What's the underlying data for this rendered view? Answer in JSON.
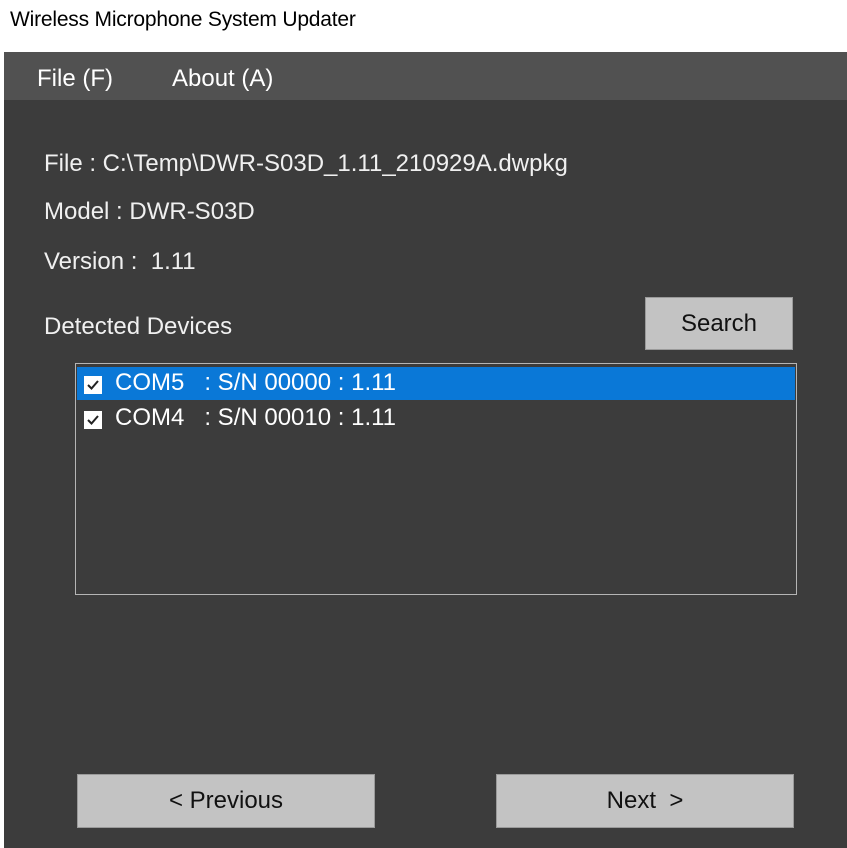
{
  "window": {
    "title": "Wireless Microphone System Updater"
  },
  "menu": {
    "items": [
      {
        "label": "File (F)"
      },
      {
        "label": "About (A)"
      }
    ]
  },
  "info": {
    "file_line": "File : C:\\Temp\\DWR-S03D_1.11_210929A.dwpkg",
    "model_line": "Model : DWR-S03D",
    "version_line": "Version :  1.11"
  },
  "devices": {
    "label": "Detected Devices",
    "search_label": "Search",
    "rows": [
      {
        "text": "COM5   : S/N 00000 : 1.11",
        "checked": true,
        "selected": true
      },
      {
        "text": "COM4   : S/N 00010 : 1.11",
        "checked": true,
        "selected": false
      }
    ]
  },
  "nav": {
    "previous_label": "< Previous",
    "next_label": "Next  >"
  },
  "colors": {
    "panel_bg": "#3c3c3c",
    "menubar_bg": "#515151",
    "selection": "#0a78d7",
    "button_bg": "#c3c3c3"
  }
}
